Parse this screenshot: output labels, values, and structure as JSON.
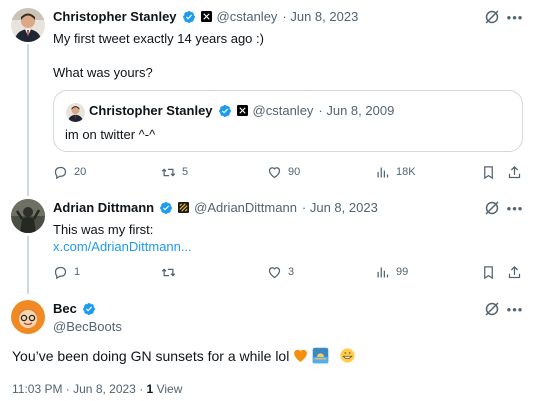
{
  "tweets": [
    {
      "name": "Christopher Stanley",
      "handle": "@cstanley",
      "date": "· Jun 8, 2023",
      "text_line1": "My first tweet exactly 14 years ago :)",
      "text_line2": "What was yours?",
      "quote": {
        "name": "Christopher Stanley",
        "handle": "@cstanley",
        "date": "· Jun 8, 2009",
        "text": "im on twitter ^-^"
      },
      "stats": {
        "replies": "20",
        "reposts": "5",
        "likes": "90",
        "views": "18K"
      }
    },
    {
      "name": "Adrian Dittmann",
      "handle": "@AdrianDittmann",
      "date": "· Jun 8, 2023",
      "text_line1": "This was my first:",
      "link": "x.com/AdrianDittmann...",
      "stats": {
        "replies": "1",
        "reposts": "",
        "likes": "3",
        "views": "99"
      }
    }
  ],
  "main_tweet": {
    "name": "Bec",
    "handle": "@BecBoots",
    "text": "You’ve been doing GN sunsets for a while lol",
    "time": "11:03 PM · Jun 8, 2023 ·",
    "views_count": "1",
    "views_label": "View"
  },
  "colors": {
    "accent": "#1d9bf0",
    "muted": "#536471",
    "border": "#cfd9de"
  },
  "icons": [
    "verified-icon",
    "x-logo-icon",
    "grok-icon",
    "more-icon",
    "reply-icon",
    "repost-icon",
    "like-icon",
    "views-icon",
    "bookmark-icon",
    "share-icon"
  ]
}
